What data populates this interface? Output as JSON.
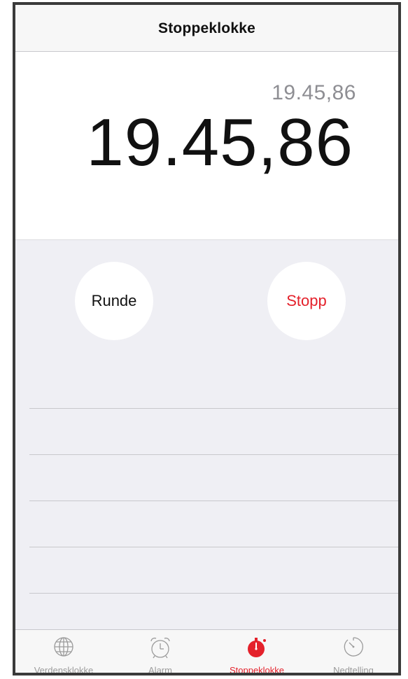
{
  "nav": {
    "title": "Stoppeklokke"
  },
  "stopwatch": {
    "lap_time": "19.45,86",
    "main_time": "19.45,86"
  },
  "buttons": {
    "lap_label": "Runde",
    "stop_label": "Stopp"
  },
  "colors": {
    "accent": "#e4212b",
    "background_lower": "#efeff4",
    "tab_inactive": "#9b9b9b"
  },
  "tabs": [
    {
      "label": "Verdensklokke",
      "icon": "globe-icon",
      "active": false
    },
    {
      "label": "Alarm",
      "icon": "alarm-clock-icon",
      "active": false
    },
    {
      "label": "Stoppeklokke",
      "icon": "stopwatch-icon",
      "active": true
    },
    {
      "label": "Nedtelling",
      "icon": "timer-icon",
      "active": false
    }
  ]
}
